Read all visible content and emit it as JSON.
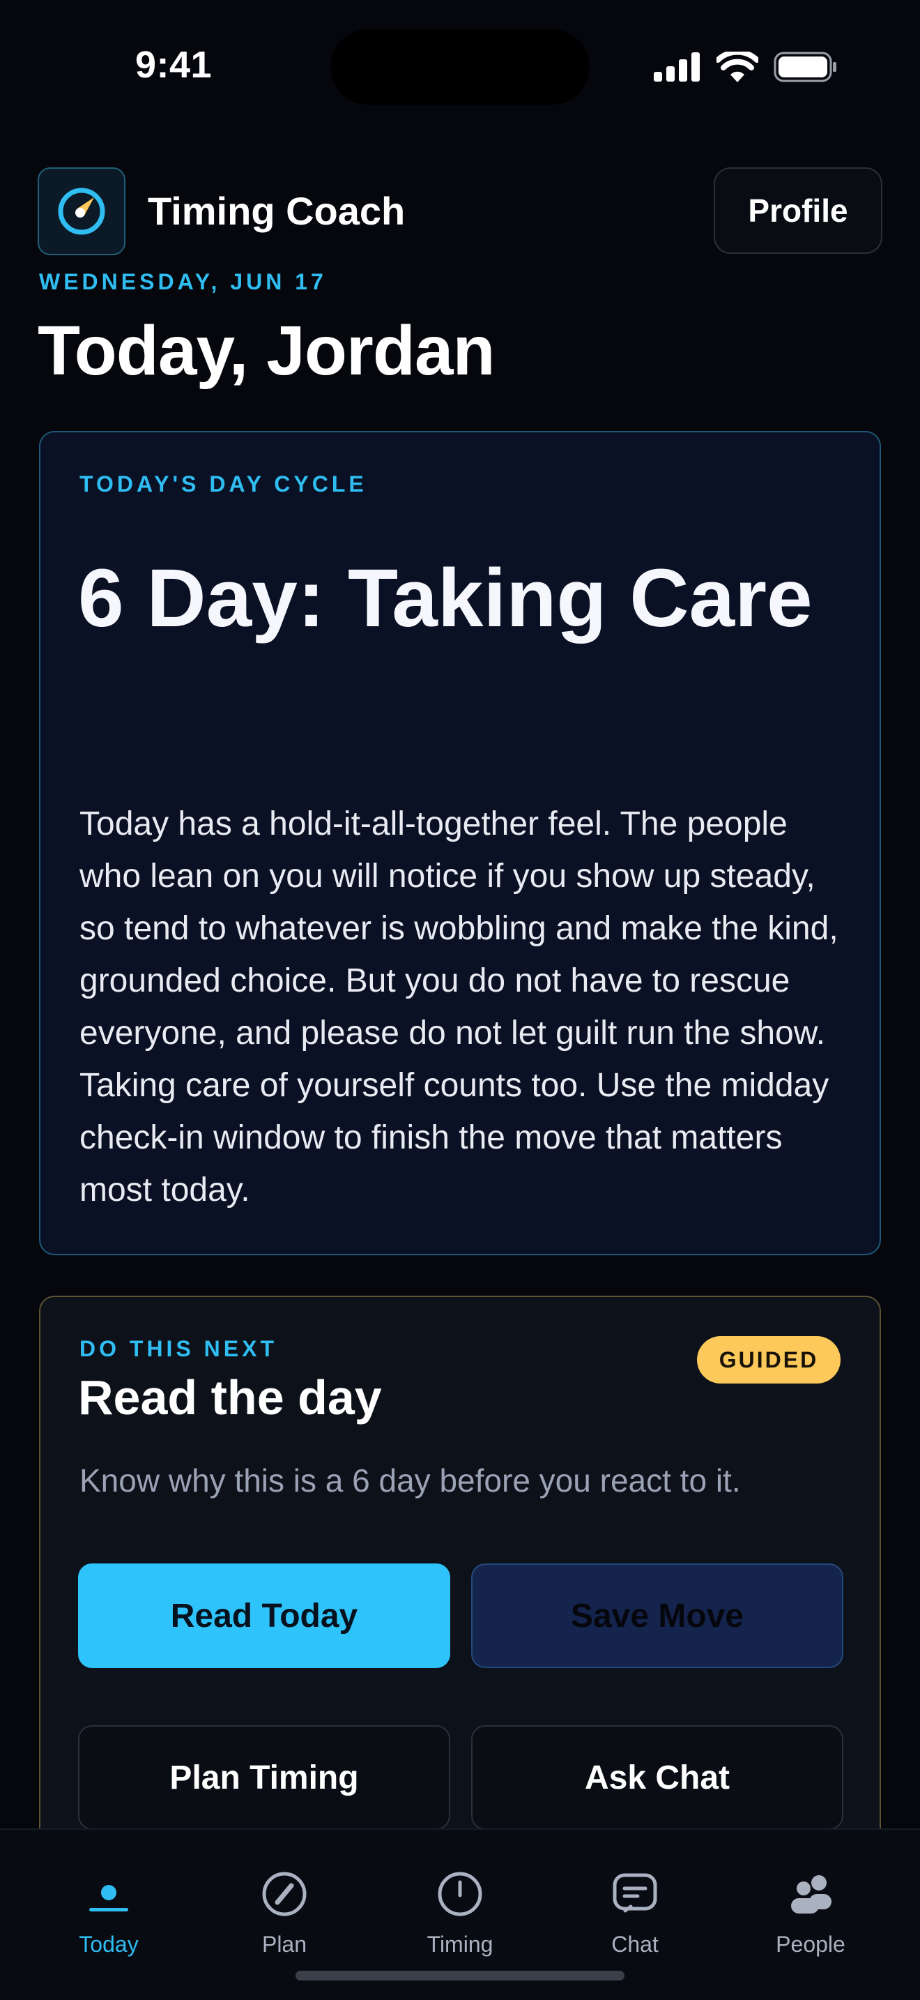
{
  "status_bar": {
    "time": "9:41"
  },
  "header": {
    "app_title": "Timing Coach",
    "profile_label": "Profile",
    "logo_icon": "compass-icon"
  },
  "date_eyebrow": "WEDNESDAY, JUN 17",
  "page_title": "Today, Jordan",
  "cycle_card": {
    "eyebrow": "TODAY'S DAY CYCLE",
    "title": "6 Day: Taking Care",
    "body": "Today has a hold-it-all-together feel. The people who lean on you will notice if you show up steady, so tend to whatever is wobbling and make the kind, grounded choice. But you do not have to rescue everyone, and please do not let guilt run the show. Taking care of yourself counts too. Use the midday check-in window to finish the move that matters most today."
  },
  "next_card": {
    "eyebrow": "DO THIS NEXT",
    "badge": "GUIDED",
    "title": "Read the day",
    "description": "Know why this is a 6 day before you react to it.",
    "buttons": {
      "read_today": "Read Today",
      "save_move": "Save Move",
      "plan_timing": "Plan Timing",
      "ask_chat": "Ask Chat"
    }
  },
  "tab_bar": {
    "active": "Today",
    "tabs": [
      {
        "label": "Today",
        "icon": "today-dot-icon"
      },
      {
        "label": "Plan",
        "icon": "pencil-circle-icon"
      },
      {
        "label": "Timing",
        "icon": "clock-icon"
      },
      {
        "label": "Chat",
        "icon": "chat-bubble-icon"
      },
      {
        "label": "People",
        "icon": "people-icon"
      }
    ]
  },
  "colors": {
    "accent": "#2fbdf2",
    "badge": "#fcc95a",
    "background": "#05070c"
  }
}
